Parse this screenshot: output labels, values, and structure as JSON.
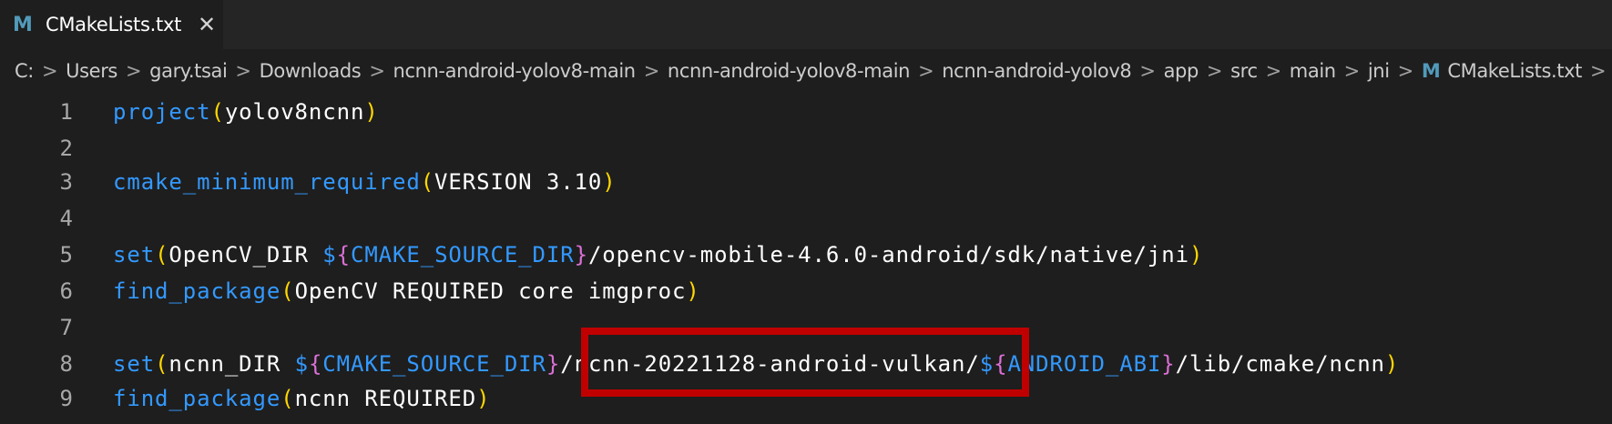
{
  "tab": {
    "icon": "M",
    "title": "CMakeLists.txt",
    "close": "✕"
  },
  "breadcrumb": {
    "items": [
      "C:",
      "Users",
      "gary.tsai",
      "Downloads",
      "ncnn-android-yolov8-main",
      "ncnn-android-yolov8-main",
      "ncnn-android-yolov8",
      "app",
      "src",
      "main",
      "jni"
    ],
    "file_icon": "M",
    "file": "CMakeLists.txt",
    "separator": ">"
  },
  "lines": [
    {
      "n": "1",
      "tokens": [
        [
          "fn",
          "project"
        ],
        [
          "p1",
          "("
        ],
        [
          "txt",
          "yolov8ncnn"
        ],
        [
          "p1",
          ")"
        ]
      ]
    },
    {
      "n": "2",
      "tokens": []
    },
    {
      "n": "3",
      "tokens": [
        [
          "fn",
          "cmake_minimum_required"
        ],
        [
          "p1",
          "("
        ],
        [
          "txt",
          "VERSION 3.10"
        ],
        [
          "p1",
          ")"
        ]
      ]
    },
    {
      "n": "4",
      "tokens": []
    },
    {
      "n": "5",
      "tokens": [
        [
          "fn",
          "set"
        ],
        [
          "p1",
          "("
        ],
        [
          "txt",
          "OpenCV_DIR "
        ],
        [
          "var",
          "$"
        ],
        [
          "p2",
          "{"
        ],
        [
          "var",
          "CMAKE_SOURCE_DIR"
        ],
        [
          "p2",
          "}"
        ],
        [
          "txt",
          "/opencv-mobile-4.6.0-android/sdk/native/jni"
        ],
        [
          "p1",
          ")"
        ]
      ]
    },
    {
      "n": "6",
      "tokens": [
        [
          "fn",
          "find_package"
        ],
        [
          "p1",
          "("
        ],
        [
          "txt",
          "OpenCV REQUIRED core imgproc"
        ],
        [
          "p1",
          ")"
        ]
      ]
    },
    {
      "n": "7",
      "tokens": []
    },
    {
      "n": "8",
      "tokens": [
        [
          "fn",
          "set"
        ],
        [
          "p1",
          "("
        ],
        [
          "txt",
          "ncnn_DIR "
        ],
        [
          "var",
          "$"
        ],
        [
          "p2",
          "{"
        ],
        [
          "var",
          "CMAKE_SOURCE_DIR"
        ],
        [
          "p2",
          "}"
        ],
        [
          "txt",
          "/ncnn-20221128-android-vulkan/"
        ],
        [
          "var",
          "$"
        ],
        [
          "p2",
          "{"
        ],
        [
          "var",
          "ANDROID_ABI"
        ],
        [
          "p2",
          "}"
        ],
        [
          "txt",
          "/lib/cmake/ncnn"
        ],
        [
          "p1",
          ")"
        ]
      ]
    },
    {
      "n": "9",
      "tokens": [
        [
          "fn",
          "find_package"
        ],
        [
          "p1",
          "("
        ],
        [
          "txt",
          "ncnn REQUIRED"
        ],
        [
          "p1",
          ")"
        ]
      ]
    }
  ],
  "colors": {
    "background": "#1e1e1e",
    "function": "#3399ff",
    "paren_outer": "#ffd700",
    "brace": "#da70d6",
    "highlight_box": "#c00000"
  },
  "icons": [
    "markdown-file-icon",
    "close-icon",
    "chevron-right-icon"
  ]
}
